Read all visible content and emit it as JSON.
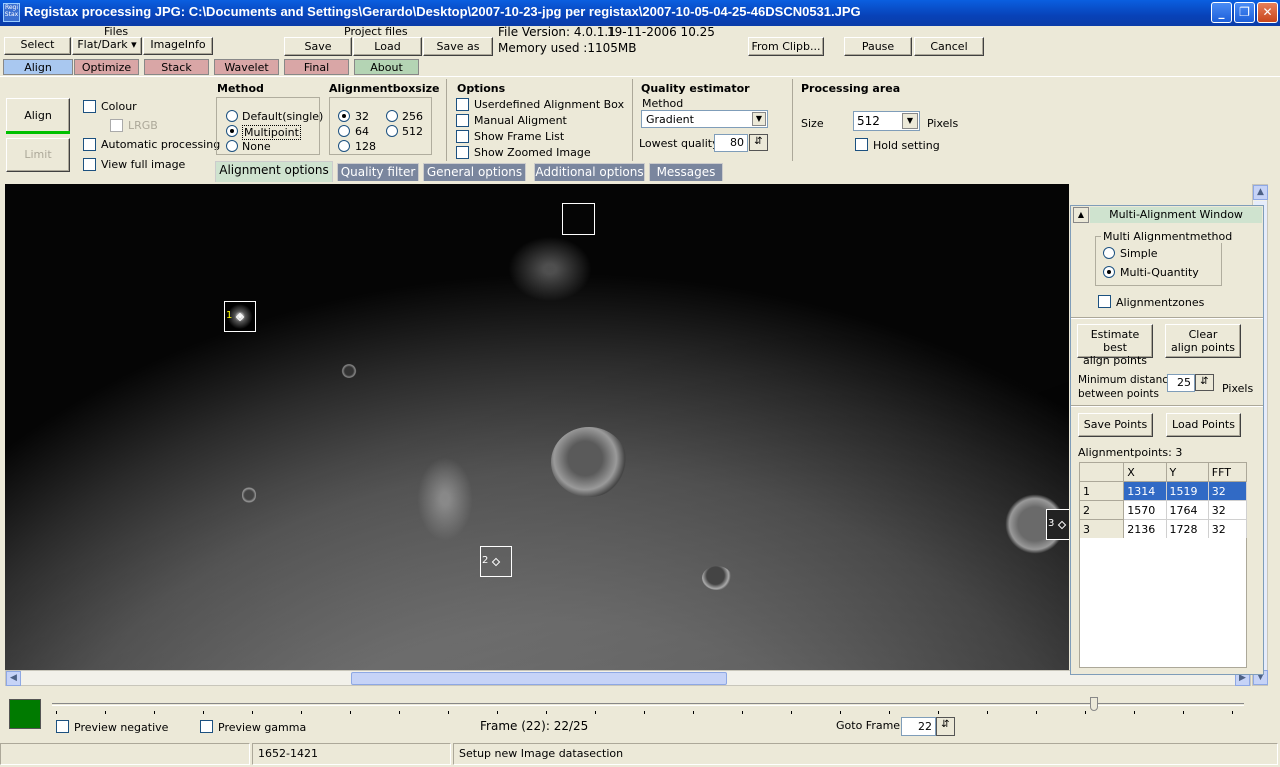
{
  "window": {
    "title": "Registax processing JPG: C:\\Documents and Settings\\Gerardo\\Desktop\\2007-10-23-jpg per registax\\2007-10-05-04-25-46DSCN0531.JPG",
    "app_icon_text": "Regi Stax",
    "minimize": "_",
    "maximize": "❐",
    "close": "✕"
  },
  "toolbar": {
    "files_label": "Files",
    "select": "Select",
    "flat_dark": "Flat/Dark ▾",
    "imageinfo": "ImageInfo",
    "project_files_label": "Project files",
    "save": "Save",
    "load": "Load",
    "save_as": "Save as",
    "file_version": "File Version: 4.0.1.1",
    "file_date": "19-11-2006 10.25",
    "memory_used": "Memory used :1105MB",
    "from_clipboard": "From Clipb...",
    "pause": "Pause",
    "cancel": "Cancel"
  },
  "tabs": [
    {
      "label": "Align",
      "color": "#a9c8f0"
    },
    {
      "label": "Optimize",
      "color": "#d9a6a6"
    },
    {
      "label": "Stack",
      "color": "#d9a6a6"
    },
    {
      "label": "Wavelet",
      "color": "#d9a6a6"
    },
    {
      "label": "Final",
      "color": "#d9a6a6"
    },
    {
      "label": "About",
      "color": "#b4d4b4"
    }
  ],
  "align_panel": {
    "align_button": "Align",
    "limit_button": "Limit",
    "colour": "Colour",
    "lrgb": "LRGB",
    "automatic_processing": "Automatic processing",
    "view_full_image": "View full image"
  },
  "method": {
    "header": "Method",
    "options": [
      "Default(single)",
      "Multipoint",
      "None"
    ],
    "selected": "Multipoint"
  },
  "alignment_box_size": {
    "header": "Alignmentboxsize",
    "options": [
      "32",
      "64",
      "128",
      "256",
      "512"
    ],
    "selected": "32"
  },
  "options": {
    "header": "Options",
    "items": [
      "Userdefined Alignment Box",
      "Manual Aligment",
      "Show Frame List",
      "Show Zoomed Image"
    ]
  },
  "quality_estimator": {
    "header": "Quality estimator",
    "method_label": "Method",
    "method_value": "Gradient",
    "lowest_quality_label": "Lowest quality",
    "lowest_quality_value": "80"
  },
  "processing_area": {
    "header": "Processing area",
    "size_label": "Size",
    "size_value": "512",
    "pixels_label": "Pixels",
    "hold_setting": "Hold setting"
  },
  "subtabs": [
    "Alignment  options",
    "Quality  filter",
    "General options",
    "Additional options",
    "Messages"
  ],
  "image": {
    "alignment_markers": [
      "1",
      "2",
      "3"
    ]
  },
  "multi_alignment": {
    "title": "Multi-Alignment Window",
    "collapse": "▲",
    "method_group": "Multi Alignmentmethod",
    "simple": "Simple",
    "multi_quantity": "Multi-Quantity",
    "alignmentzones": "Alignmentzones",
    "estimate_best_1": "Estimate best",
    "estimate_best_2": "align points",
    "clear_1": "Clear",
    "clear_2": "align points",
    "min_distance_1": "Minimum distance",
    "min_distance_2": "between points",
    "min_distance_value": "25",
    "pixels": "Pixels",
    "save_points": "Save Points",
    "load_points": "Load Points",
    "alignmentpoints_label": "Alignmentpoints: 3",
    "columns": [
      "X",
      "Y",
      "FFT"
    ],
    "rows": [
      {
        "n": "1",
        "x": "1314",
        "y": "1519",
        "fft": "32"
      },
      {
        "n": "2",
        "x": "1570",
        "y": "1764",
        "fft": "32"
      },
      {
        "n": "3",
        "x": "2136",
        "y": "1728",
        "fft": "32"
      }
    ]
  },
  "bottom": {
    "preview_negative": "Preview negative",
    "preview_gamma": "Preview gamma",
    "frame_text": "Frame (22): 22/25",
    "goto_frame_label": "Goto Frame",
    "goto_frame_value": "22",
    "indicator_color": "#007a00"
  },
  "status": {
    "coords": "1652-1421",
    "message": "Setup new Image datasection"
  }
}
